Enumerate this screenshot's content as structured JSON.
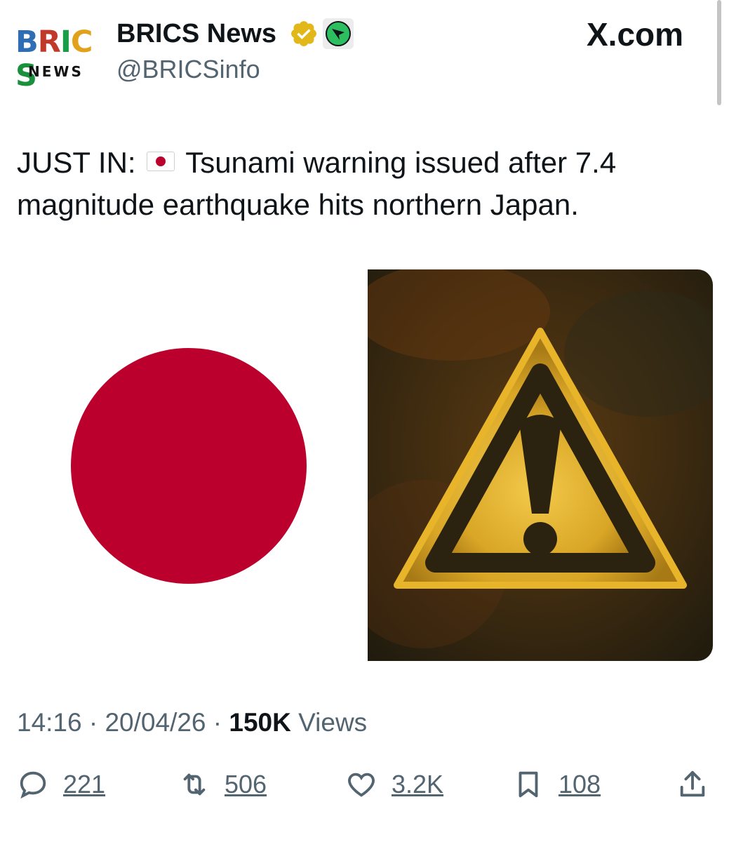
{
  "logo": {
    "brand": "BRICS",
    "sub": "NEWS"
  },
  "header": {
    "display_name": "BRICS News",
    "handle": "@BRICSinfo",
    "site": "X.com",
    "verified_color": "#e2b719"
  },
  "tweet": {
    "prefix": "JUST IN:",
    "body": "Tsunami warning issued after 7.4 magnitude earthquake hits northern Japan.",
    "flag_icon": "japan-flag-emoji"
  },
  "media": [
    {
      "name": "japan-flag-image",
      "colors": {
        "disc": "#bc002d",
        "field": "#ffffff"
      }
    },
    {
      "name": "warning-sign-image",
      "colors": {
        "sign": "#e8b42a",
        "background": "#3a2a12"
      }
    }
  ],
  "meta": {
    "time": "14:16",
    "date": "20/04/26",
    "views_count": "150K",
    "views_label": "Views",
    "separator": "·"
  },
  "actions": {
    "replies": "221",
    "reposts": "506",
    "likes": "3.2K",
    "bookmarks": "108"
  }
}
